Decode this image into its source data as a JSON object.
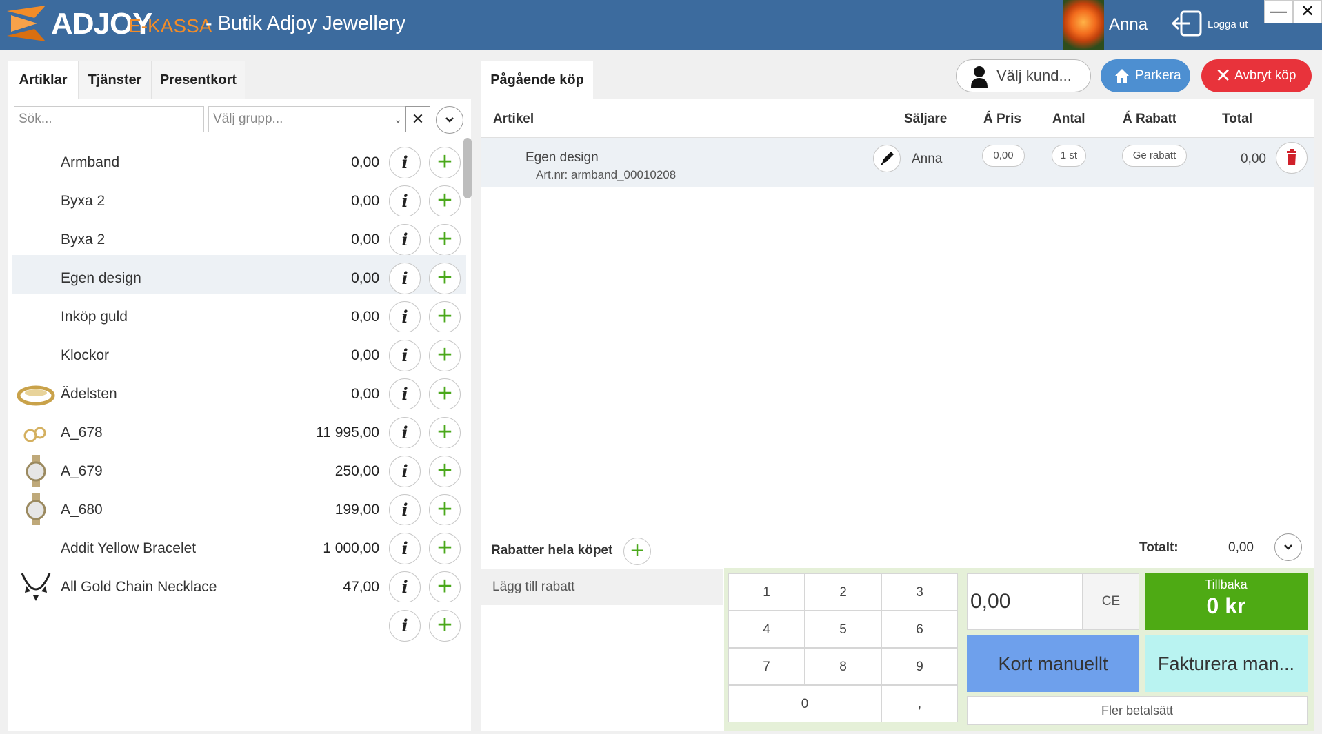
{
  "header": {
    "logo_text": "ADJOY",
    "logo_sub": "E-KASSA",
    "shop_title": "-  Butik Adjoy Jewellery",
    "user_name": "Anna",
    "logout_label": "Logga ut",
    "minimize_label": "—",
    "close_label": "✕",
    "brand_color": "#3c6b9e",
    "accent_color": "#f28c28"
  },
  "left": {
    "tabs": [
      {
        "label": "Artiklar",
        "active": true
      },
      {
        "label": "Tjänster",
        "active": false
      },
      {
        "label": "Presentkort",
        "active": false
      }
    ],
    "search": {
      "placeholder": "Sök...",
      "value": ""
    },
    "group_select": {
      "placeholder": "Välj grupp..."
    },
    "clear_label": "✕",
    "expand_label": "⌄",
    "info_label": "i",
    "add_label": "+",
    "articles": [
      {
        "name": "Armband",
        "price": "0,00",
        "thumb": "none"
      },
      {
        "name": "Byxa 2",
        "price": "0,00",
        "thumb": "none"
      },
      {
        "name": "Byxa 2",
        "price": "0,00",
        "thumb": "none"
      },
      {
        "name": "Egen design",
        "price": "0,00",
        "thumb": "none",
        "selected": true
      },
      {
        "name": "Inköp guld",
        "price": "0,00",
        "thumb": "none"
      },
      {
        "name": "Klockor",
        "price": "0,00",
        "thumb": "none"
      },
      {
        "name": "Ädelsten",
        "price": "0,00",
        "thumb": "bracelet-icon"
      },
      {
        "name": "A_678",
        "price": "11 995,00",
        "thumb": "rings-icon"
      },
      {
        "name": "A_679",
        "price": "250,00",
        "thumb": "watch-icon"
      },
      {
        "name": "A_680",
        "price": "199,00",
        "thumb": "watch-icon"
      },
      {
        "name": "Addit Yellow Bracelet",
        "price": "1 000,00",
        "thumb": "none"
      },
      {
        "name": "All Gold Chain Necklace",
        "price": "47,00",
        "thumb": "necklace-icon"
      },
      {
        "name": "",
        "price": "",
        "thumb": "none"
      }
    ]
  },
  "right": {
    "tab_label": "Pågående köp",
    "customer_button": "Välj kund...",
    "park_button": "Parkera",
    "abort_button": "Avbryt köp",
    "columns": {
      "article": "Artikel",
      "seller": "Säljare",
      "unit_price": "Á Pris",
      "quantity": "Antal",
      "unit_discount": "Á Rabatt",
      "total": "Total"
    },
    "order_rows": [
      {
        "name": "Egen design",
        "art_nr": "Art.nr: armband_00010208",
        "seller": "Anna",
        "unit_price": "0,00",
        "quantity": "1 st",
        "discount": "Ge rabatt",
        "total": "0,00"
      }
    ],
    "discount_section_title": "Rabatter hela köpet",
    "add_discount_label": "Lägg till rabatt",
    "total_label": "Totalt:",
    "total_value": "0,00",
    "keypad": [
      "1",
      "2",
      "3",
      "4",
      "5",
      "6",
      "7",
      "8",
      "9",
      "0",
      ","
    ],
    "amount_value": "0,00",
    "ce_label": "CE",
    "change_label": "Tillbaka",
    "change_value": "0 kr",
    "card_manual_button": "Kort manuellt",
    "invoice_button": "Fakturera man...",
    "more_payment": "Fler betalsätt",
    "colors": {
      "change_bg": "#4eaa14",
      "card_bg": "#6ea0ec",
      "invoice_bg": "#b9f3f1",
      "abort_bg": "#e8333b",
      "park_bg": "#4d8fd1",
      "add_green": "#4aa81b"
    }
  }
}
